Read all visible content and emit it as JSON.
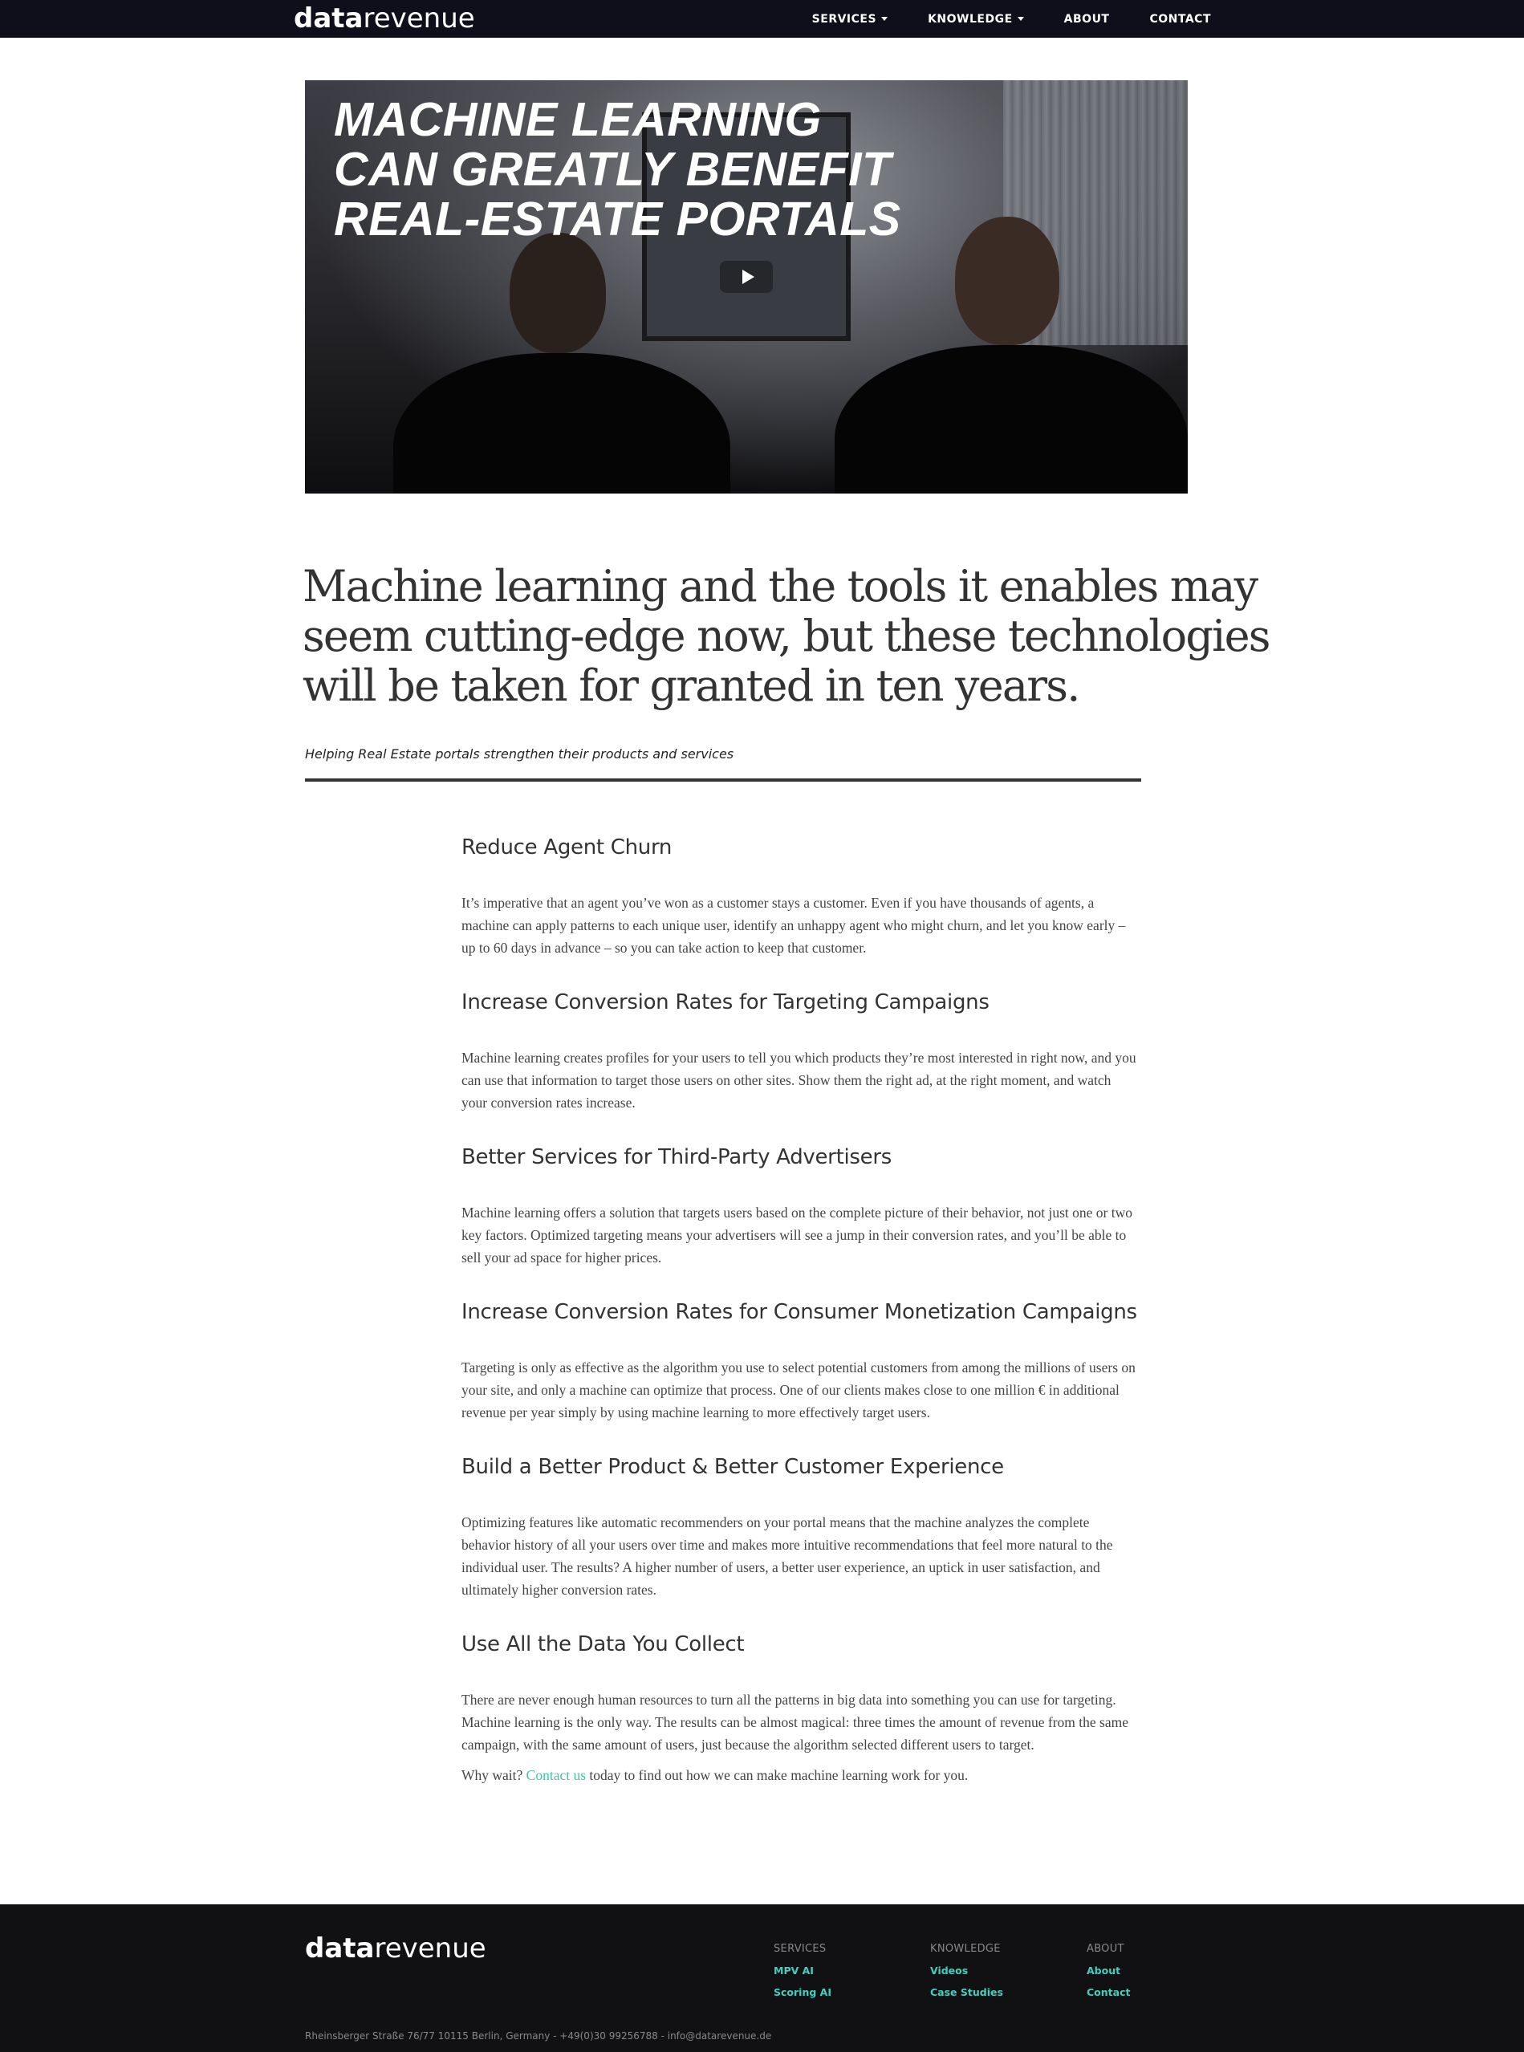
{
  "brand": {
    "logo_bold": "data",
    "logo_light": "revenue"
  },
  "nav": {
    "items": [
      {
        "label": "SERVICES",
        "dropdown": true
      },
      {
        "label": "KNOWLEDGE",
        "dropdown": true
      },
      {
        "label": "ABOUT",
        "dropdown": false
      },
      {
        "label": "CONTACT",
        "dropdown": false
      }
    ]
  },
  "hero": {
    "title_lines": [
      "MACHINE LEARNING",
      "CAN GREATLY BENEFIT",
      "REAL-ESTATE PORTALS"
    ],
    "play_icon": "play-icon"
  },
  "lead": {
    "lines": [
      "Machine learning and the tools it enables may",
      "seem cutting-edge now, but these technologies",
      "will be taken for granted in ten years."
    ],
    "tagline": "Helping Real Estate portals strengthen their products and services"
  },
  "sections": [
    {
      "heading": "Reduce Agent Churn",
      "body": "It’s imperative that an agent you’ve won as a customer stays a customer. Even if you have thousands of agents, a machine can apply patterns to each unique user, identify an unhappy agent who might churn, and let you know early – up to 60 days in advance – so you can take action to keep that customer."
    },
    {
      "heading": "Increase Conversion Rates for Targeting Campaigns",
      "body": "Machine learning creates profiles for your users to tell you which products they’re most interested in right now, and you can use that information to target those users on other sites. Show them the right ad, at the right moment, and watch your conversion rates increase."
    },
    {
      "heading": "Better Services for Third-Party Advertisers",
      "body": "Machine learning offers a solution that targets users based on the complete picture of their behavior, not just one or two key factors. Optimized targeting means your advertisers will see a jump in their conversion rates, and you’ll be able to sell your ad space for higher prices."
    },
    {
      "heading": "Increase Conversion Rates for Consumer Monetization Campaigns",
      "body": "Targeting is only as effective as the algorithm you use to select potential customers from among the millions of users on your site, and only a machine can optimize that process. One of our clients makes close to one million € in additional revenue per year simply by using machine learning to more effectively target users."
    },
    {
      "heading": "Build a Better Product & Better Customer Experience",
      "body": "Optimizing features like automatic recommenders on your portal means that the machine analyzes the complete behavior history of all your users over time and makes more intuitive recommendations that feel more natural to the individual user. The results? A higher number of users, a better user experience, an uptick in user satisfaction, and ultimately higher conversion rates."
    },
    {
      "heading": "Use All the Data You Collect",
      "body": "There are never enough human resources to turn all the patterns in big data into something you can use for targeting. Machine learning is the only way. The results can be almost magical: three times the amount of revenue from the same campaign, with the same amount of users, just because the algorithm selected different users to target."
    }
  ],
  "closing": {
    "before": "Why wait? ",
    "link": "Contact us",
    "after": " today to find out how we can make machine learning work for you."
  },
  "footer": {
    "logo_bold": "data",
    "logo_light": "revenue",
    "columns": [
      {
        "title": "SERVICES",
        "links": [
          "MPV AI",
          "Scoring AI"
        ]
      },
      {
        "title": "KNOWLEDGE",
        "links": [
          "Videos",
          "Case Studies"
        ]
      },
      {
        "title": "ABOUT",
        "links": [
          "About",
          "Contact"
        ]
      }
    ],
    "address": "Rheinsberger Straße 76/77 10115 Berlin, Germany - +49(0)30 99256788 - info@datarevenue.de"
  },
  "colors": {
    "nav_bg": "#0f0f1c",
    "accent": "#3fc6a6",
    "footer_bg": "#111114"
  }
}
